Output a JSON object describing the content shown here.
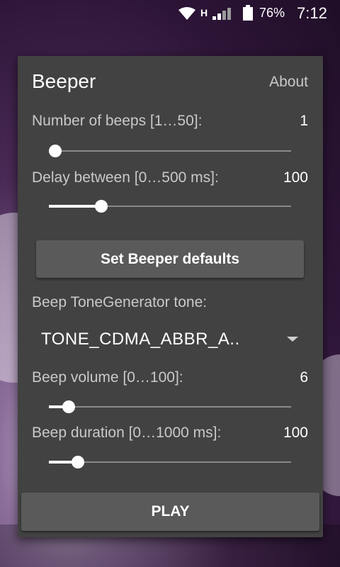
{
  "status_bar": {
    "network_type": "H",
    "battery": "76%",
    "time": "7:12"
  },
  "dialog": {
    "title": "Beeper",
    "about": "About",
    "beeps": {
      "label": "Number of beeps [1…50]:",
      "value": "1",
      "min": 1,
      "max": 50,
      "current": 1
    },
    "delay": {
      "label": "Delay between [0…500 ms]:",
      "value": "100",
      "min": 0,
      "max": 500,
      "current": 100
    },
    "defaults_button": "Set Beeper defaults",
    "tone": {
      "label": "Beep ToneGenerator tone:",
      "selected": "TONE_CDMA_ABBR_A.."
    },
    "volume": {
      "label": "Beep volume [0…100]:",
      "value": "6",
      "min": 0,
      "max": 100,
      "current": 6
    },
    "duration": {
      "label": "Beep duration [0…1000 ms]:",
      "value": "100",
      "min": 0,
      "max": 1000,
      "current": 100
    },
    "play_button": "PLAY"
  },
  "icons": [
    "wifi-icon",
    "signal-icon",
    "battery-icon",
    "chevron-down-icon"
  ]
}
